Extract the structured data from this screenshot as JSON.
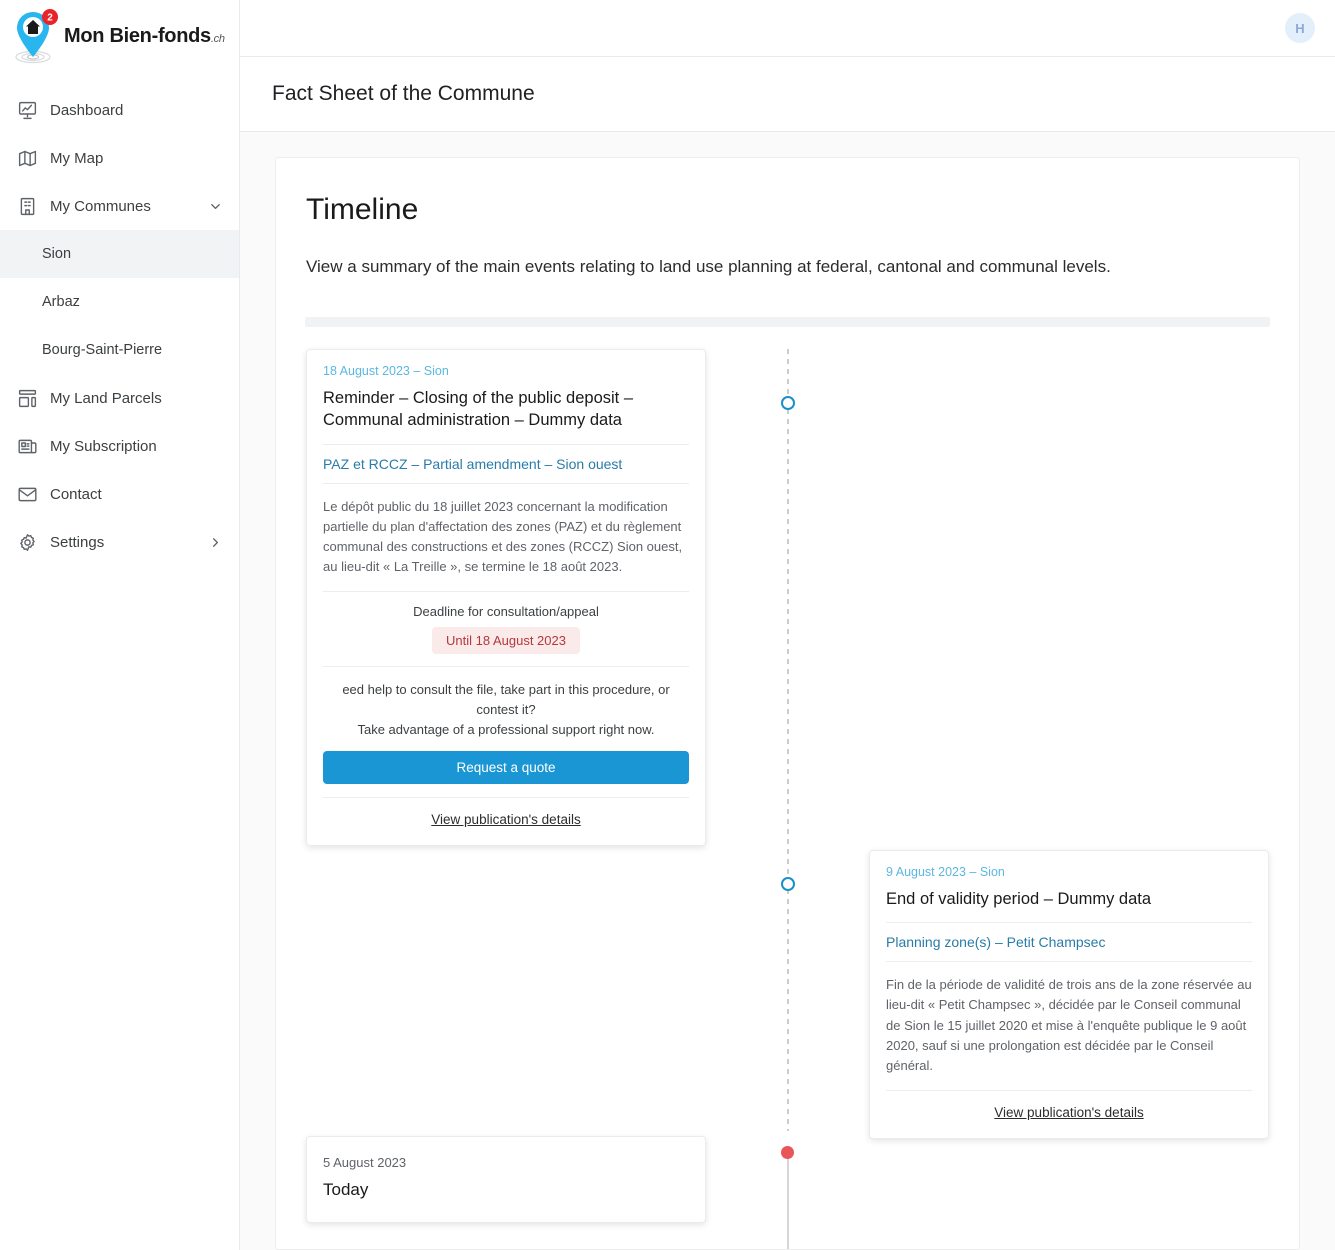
{
  "brand": {
    "name": "Mon Bien-fonds",
    "tld": ".ch",
    "badge_count": "2",
    "logo_icon": "map-pin-home-icon",
    "accent_blue": "#29b6ef"
  },
  "sidebar": {
    "items": [
      {
        "label": "Dashboard",
        "icon": "presentation-chart-icon",
        "active": false
      },
      {
        "label": "My Map",
        "icon": "map-icon",
        "active": false
      },
      {
        "label": "My Communes",
        "icon": "building-icon",
        "active": false,
        "expanded": true,
        "chevron": "chevron-down-icon"
      },
      {
        "label": "My Land Parcels",
        "icon": "layout-parcels-icon",
        "active": false
      },
      {
        "label": "My Subscription",
        "icon": "newspaper-icon",
        "active": false
      },
      {
        "label": "Contact",
        "icon": "envelope-icon",
        "active": false
      },
      {
        "label": "Settings",
        "icon": "gear-icon",
        "active": false,
        "chevron": "chevron-right-icon"
      }
    ],
    "communes": [
      {
        "label": "Sion",
        "active": true
      },
      {
        "label": "Arbaz",
        "active": false
      },
      {
        "label": "Bourg-Saint-Pierre",
        "active": false
      }
    ]
  },
  "topbar": {
    "avatar_initial": "H",
    "avatar_bg": "#e3f0fb",
    "avatar_fg": "#8fa8d9"
  },
  "page": {
    "title": "Fact Sheet of the Commune"
  },
  "timeline": {
    "heading": "Timeline",
    "description": "View a summary of the main events relating to land use planning at federal, cantonal and communal levels.",
    "events": [
      {
        "side": "left",
        "marker": "ring",
        "date": "18 August 2023 – Sion",
        "title": "Reminder – Closing of the public deposit – Communal administration – Dummy data",
        "subtitle": "PAZ et RCCZ – Partial amendment – Sion ouest",
        "body": "Le dépôt public du 18 juillet 2023 concernant la modification partielle du plan d'affectation des zones (PAZ) et du règlement communal des constructions et des zones (RCCZ) Sion ouest, au lieu-dit « La Treille », se termine le 18 août 2023.",
        "deadline_label": "Deadline for consultation/appeal",
        "deadline_badge": "Until 18 August 2023",
        "deadline_badge_bg": "#fbeaea",
        "deadline_badge_fg": "#b5383c",
        "promo_line1": "eed help to consult the file, take part in this procedure, or contest it?",
        "promo_line2": "Take advantage of a professional support right now.",
        "cta_label": "Request a quote",
        "cta_color": "#1a96d4",
        "details_label": "View publication's details"
      },
      {
        "side": "right",
        "marker": "ring",
        "date": "9 August 2023 – Sion",
        "title": "End of validity period – Dummy data",
        "subtitle": "Planning zone(s) – Petit Champsec",
        "body": "Fin de la période de validité de trois ans de la zone réservée au lieu-dit « Petit Champsec », décidée par le Conseil communal de Sion le 15 juillet 2020 et mise à l'enquête publique le 9 août 2020, sauf si une prolongation est décidée par le Conseil général.",
        "details_label": "View publication's details"
      },
      {
        "side": "left",
        "marker": "today",
        "marker_color": "#e8565a",
        "date": "5 August 2023",
        "title": "Today"
      }
    ]
  }
}
